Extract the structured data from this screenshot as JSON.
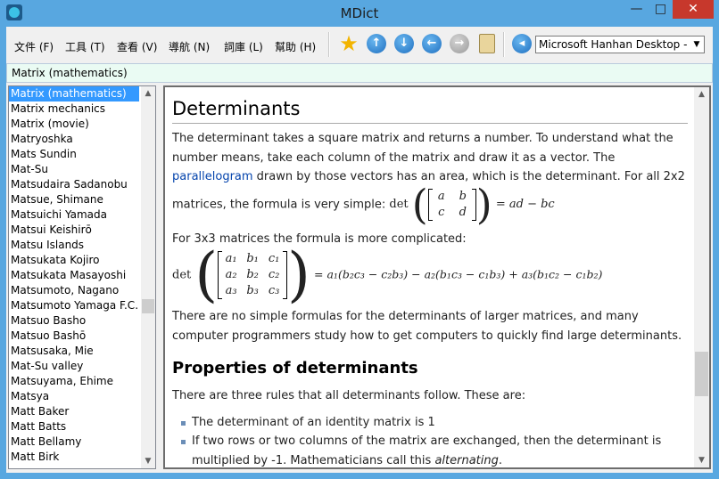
{
  "window": {
    "title": "MDict",
    "minimize": "—",
    "maximize": "□",
    "close": "✕"
  },
  "menu": [
    "文件 (F)",
    "工具 (T)",
    "查看 (V)",
    "導航 (N)",
    "詞庫 (L)",
    "幫助 (H)"
  ],
  "toolbar": {
    "icons": [
      "star-icon",
      "up-arrow-icon",
      "down-arrow-icon",
      "back-arrow-icon",
      "forward-arrow-icon",
      "clipboard-icon",
      "speaker-icon"
    ],
    "dictionary": "Microsoft Hanhan Desktop - C"
  },
  "search": {
    "value": "Matrix (mathematics)"
  },
  "wordlist": [
    "Matrix (mathematics)",
    "Matrix mechanics",
    "Matrix (movie)",
    "Matryoshka",
    "Mats Sundin",
    "Mat-Su",
    "Matsudaira Sadanobu",
    "Matsue, Shimane",
    "Matsuichi Yamada",
    "Matsui Keishirō",
    "Matsu Islands",
    "Matsukata Kojiro",
    "Matsukata Masayoshi",
    "Matsumoto, Nagano",
    "Matsumoto Yamaga F.C.",
    "Matsuo Basho",
    "Matsuo Bashō",
    "Matsusaka, Mie",
    "Mat-Su valley",
    "Matsuyama, Ehime",
    "Matsya",
    "Matt Baker",
    "Matt Batts",
    "Matt Bellamy",
    "Matt Birk"
  ],
  "article": {
    "heading": "Determinants",
    "p1_a": "The determinant takes a square matrix and returns a number. To understand what the number means, take each column of the matrix and draw it as a vector. The ",
    "p1_link": "parallelogram",
    "p1_b": " drawn by those vectors has an area, which is the determinant. For all 2x2 matrices, the formula is very simple: ",
    "det2": {
      "det": "det",
      "cells": [
        "a",
        "b",
        "c",
        "d"
      ],
      "rhs": "= ad − bc"
    },
    "p2": "For 3x3 matrices the formula is more complicated:",
    "det3": {
      "det": "det",
      "cells": [
        "a₁",
        "b₁",
        "c₁",
        "a₂",
        "b₂",
        "c₂",
        "a₃",
        "b₃",
        "c₃"
      ],
      "rhs": "= a₁(b₂c₃ − c₂b₃) − a₂(b₁c₃ − c₁b₃) + a₃(b₁c₂ − c₁b₂)"
    },
    "p3": "There are no simple formulas for the determinants of larger matrices, and many computer programmers study how to get computers to quickly find large determinants.",
    "heading2": "Properties of determinants",
    "p4": "There are three rules that all determinants follow. These are:",
    "rule1": "The determinant of an identity matrix is 1",
    "rule2_a": "If two rows or two columns of the matrix are exchanged, then the determinant is multiplied by -1. Mathematicians call this ",
    "rule2_em": "alternating",
    "rule2_b": "."
  }
}
